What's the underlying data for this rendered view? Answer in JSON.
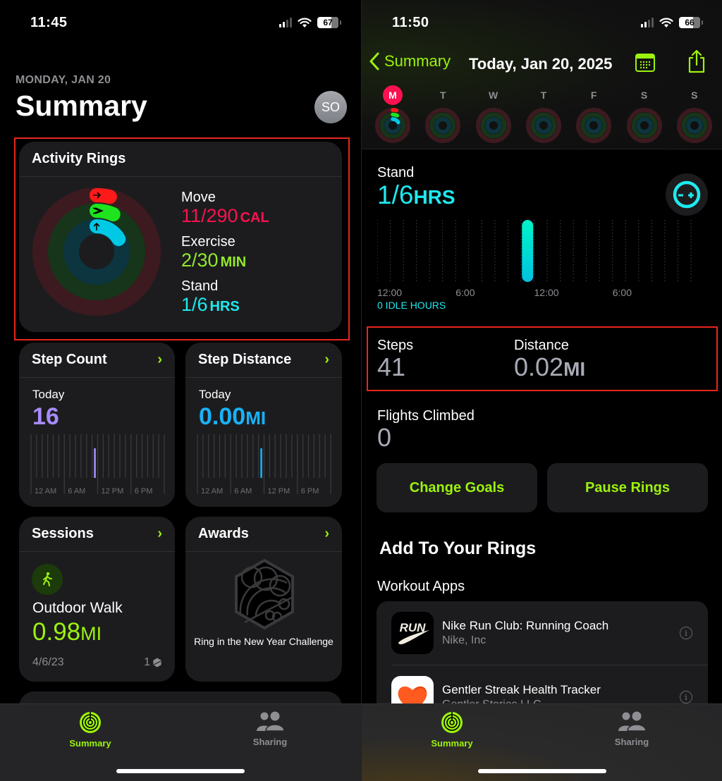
{
  "left_screen": {
    "status_bar": {
      "time": "11:45",
      "battery": "67"
    },
    "header": {
      "date": "MONDAY, JAN 20",
      "title": "Summary",
      "avatar_initials": "SO"
    },
    "activity_rings": {
      "title": "Activity Rings",
      "move": {
        "label": "Move",
        "value": "11/290",
        "unit": "CAL",
        "progress": 0.038,
        "color": "#fa114f"
      },
      "exercise": {
        "label": "Exercise",
        "value": "2/30",
        "unit": "MIN",
        "progress": 0.067,
        "color": "#92e82a"
      },
      "stand": {
        "label": "Stand",
        "value": "1/6",
        "unit": "HRS",
        "progress": 0.167,
        "color": "#1eeaef"
      }
    },
    "step_count": {
      "title": "Step Count",
      "period": "Today",
      "value": "16",
      "color": "#a78bfa",
      "axis_labels": [
        "12 AM",
        "6 AM",
        "12 PM",
        "6 PM"
      ],
      "active_hour": 11
    },
    "step_distance": {
      "title": "Step Distance",
      "period": "Today",
      "value": "0.00",
      "unit": "MI",
      "color": "#1ab1f5",
      "axis_labels": [
        "12 AM",
        "6 AM",
        "12 PM",
        "6 PM"
      ],
      "active_hour": 11
    },
    "sessions": {
      "title": "Sessions",
      "workout_name": "Outdoor Walk",
      "distance": "0.98",
      "unit": "MI",
      "date": "4/6/23",
      "count": "1"
    },
    "awards": {
      "title": "Awards",
      "award_name": "Ring in the New Year Challenge"
    },
    "tab_bar": {
      "tabs": [
        {
          "label": "Summary",
          "active": true
        },
        {
          "label": "Sharing",
          "active": false
        }
      ]
    }
  },
  "right_screen": {
    "status_bar": {
      "time": "11:50",
      "battery": "66"
    },
    "nav": {
      "back_label": "Summary",
      "title": "Today, Jan 20, 2025"
    },
    "week": {
      "days": [
        {
          "letter": "M",
          "today": true
        },
        {
          "letter": "T",
          "today": false
        },
        {
          "letter": "W",
          "today": false
        },
        {
          "letter": "T",
          "today": false
        },
        {
          "letter": "F",
          "today": false
        },
        {
          "letter": "S",
          "today": false
        },
        {
          "letter": "S",
          "today": false
        }
      ]
    },
    "stand": {
      "label": "Stand",
      "value": "1/6",
      "unit": "HRS",
      "axis_labels": [
        "12:00",
        "6:00",
        "12:00",
        "6:00"
      ],
      "stood_hours": [
        11
      ],
      "idle_hours": "0 IDLE HOURS"
    },
    "steps": {
      "label": "Steps",
      "value": "41"
    },
    "distance": {
      "label": "Distance",
      "value": "0.02",
      "unit": "MI"
    },
    "flights": {
      "label": "Flights Climbed",
      "value": "0"
    },
    "buttons": {
      "change_goals": "Change Goals",
      "pause_rings": "Pause Rings"
    },
    "add_section": {
      "heading": "Add To Your Rings",
      "subheading": "Workout Apps",
      "apps": [
        {
          "name": "Nike Run Club: Running Coach",
          "developer": "Nike, Inc",
          "icon_text": "RUN"
        },
        {
          "name": "Gentler Streak Health Tracker",
          "developer": "Gentler Stories LLC"
        }
      ]
    },
    "tab_bar": {
      "tabs": [
        {
          "label": "Summary",
          "active": true
        },
        {
          "label": "Sharing",
          "active": false
        }
      ]
    }
  },
  "colors": {
    "accent": "#9cf20d",
    "card_bg": "#1c1c1e",
    "highlight_box": "#e8261c"
  }
}
